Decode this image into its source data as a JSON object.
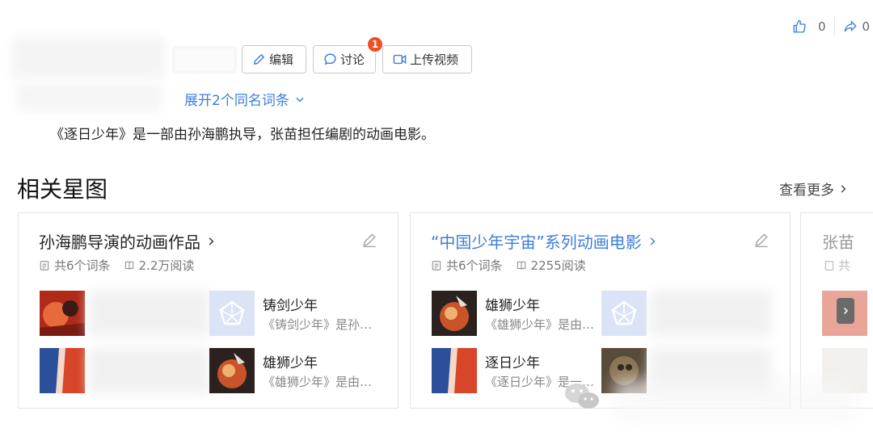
{
  "top_actions": {
    "like_count": "0",
    "share_count": "0"
  },
  "toolbar": {
    "edit_label": "编辑",
    "discuss_label": "讨论",
    "discuss_badge": "1",
    "upload_label": "上传视频"
  },
  "expand_label": "展开2个同名词条",
  "summary": "《逐日少年》是一部由孙海鹏执导，张苗担任编剧的动画电影。",
  "section": {
    "title": "相关星图",
    "more_label": "查看更多"
  },
  "cards": [
    {
      "title": "孙海鹏导演的动画作品",
      "entries": "共6个词条",
      "reads": "2.2万阅读",
      "items": [
        {
          "name": "",
          "desc": ""
        },
        {
          "name": "铸剑少年",
          "desc": "《铸剑少年》是孙…"
        },
        {
          "name": "",
          "desc": ""
        },
        {
          "name": "雄狮少年",
          "desc": "《雄狮少年》是由…"
        }
      ]
    },
    {
      "title": "“中国少年宇宙”系列动画电影",
      "entries": "共6个词条",
      "reads": "2255阅读",
      "items": [
        {
          "name": "雄狮少年",
          "desc": "《雄狮少年》是由…"
        },
        {
          "name": "",
          "desc": ""
        },
        {
          "name": "逐日少年",
          "desc": "《逐日少年》是一…"
        },
        {
          "name": "",
          "desc": ""
        }
      ]
    }
  ],
  "partial_card": {
    "title": "张苗",
    "entries": "共"
  },
  "colors": {
    "link_blue": "#3b7ed8",
    "badge_red": "#f04e23"
  }
}
